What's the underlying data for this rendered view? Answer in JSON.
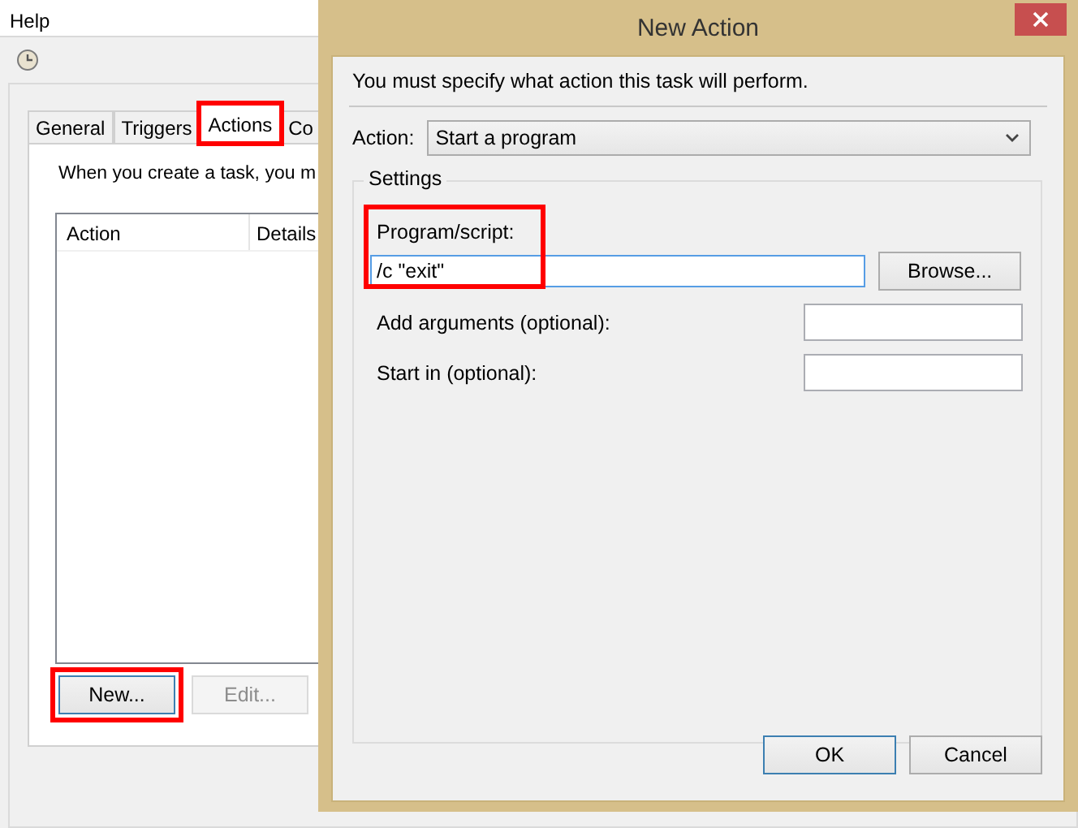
{
  "background_window": {
    "menu": [
      "Help"
    ],
    "tabs": [
      {
        "label": "General",
        "selected": false,
        "highlighted": false
      },
      {
        "label": "Triggers",
        "selected": false,
        "highlighted": false
      },
      {
        "label": "Actions",
        "selected": true,
        "highlighted": true
      },
      {
        "label": "Co",
        "selected": false,
        "highlighted": false
      }
    ],
    "description": "When you create a task, you m",
    "table": {
      "columns": [
        "Action",
        "Details"
      ]
    },
    "buttons": [
      {
        "label": "New...",
        "disabled": false,
        "highlighted": true
      },
      {
        "label": "Edit...",
        "disabled": true,
        "highlighted": false
      }
    ]
  },
  "dialog": {
    "title": "New Action",
    "instruction": "You must specify what action this task will perform.",
    "action_label": "Action:",
    "action_value": "Start a program",
    "group_title": "Settings",
    "program": {
      "label": "Program/script:",
      "value": "/c \"exit\"",
      "focused": true,
      "highlighted": true
    },
    "browse_button": "Browse...",
    "fields": [
      {
        "label": "Add arguments (optional):"
      },
      {
        "label": "Start in (optional):"
      }
    ],
    "buttons": [
      {
        "label": "OK",
        "default": true
      },
      {
        "label": "Cancel",
        "default": false
      }
    ]
  }
}
